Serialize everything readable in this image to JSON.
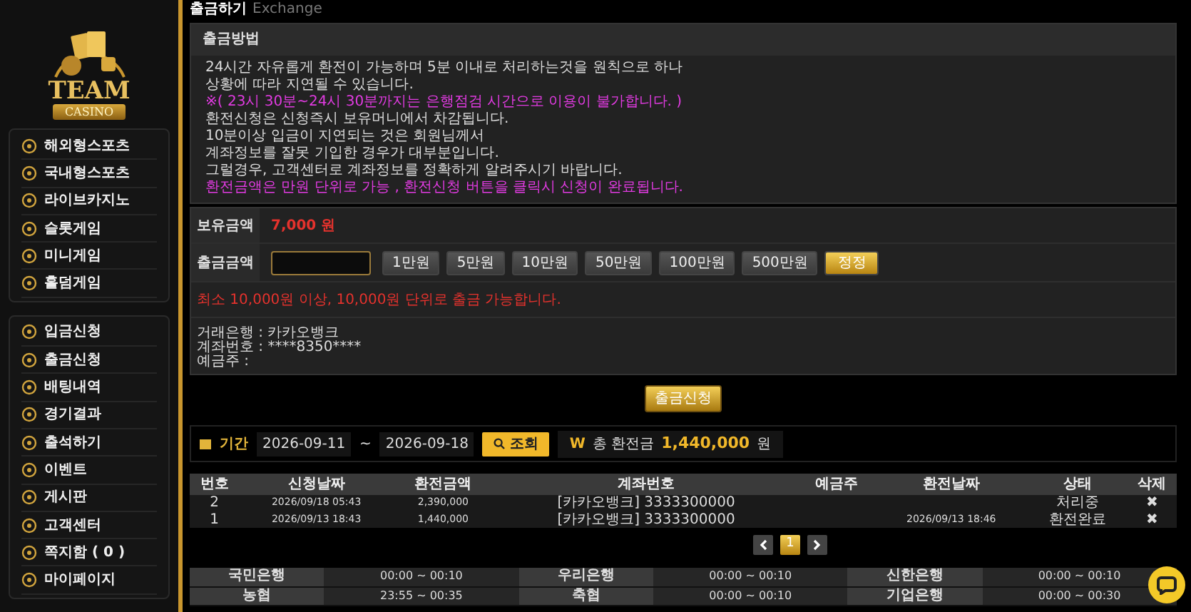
{
  "sidebar": {
    "logo": {
      "title": "TEAM",
      "subtitle": "CASINO"
    },
    "menu_groups": [
      {
        "items": [
          {
            "label": "해외형스포츠"
          },
          {
            "label": "국내형스포츠"
          },
          {
            "label": "라이브카지노"
          },
          {
            "label": "슬롯게임"
          },
          {
            "label": "미니게임"
          },
          {
            "label": "홀덤게임"
          }
        ]
      },
      {
        "items": [
          {
            "label": "입금신청"
          },
          {
            "label": "출금신청"
          },
          {
            "label": "배팅내역"
          },
          {
            "label": "경기결과"
          },
          {
            "label": "출석하기"
          },
          {
            "label": "이벤트"
          },
          {
            "label": "게시판"
          },
          {
            "label": "고객센터"
          },
          {
            "label": "쪽지함 ( 0 )"
          },
          {
            "label": "마이페이지"
          }
        ]
      }
    ]
  },
  "page_title": {
    "title": "출금하기",
    "subtitle": "Exchange"
  },
  "notice": {
    "heading": "출금방법",
    "lines": [
      {
        "text": "24시간 자유롭게 환전이 가능하며 5분 이내로 처리하는것을 원칙으로 하나",
        "kind": "normal"
      },
      {
        "text": "상황에 따라 지연될 수 있습니다.",
        "kind": "normal"
      },
      {
        "text": "※( 23시 30분~24시 30분까지는 은행점검 시간으로 이용이 불가합니다. )",
        "kind": "highlight"
      },
      {
        "text": "환전신청은 신청즉시 보유머니에서 차감됩니다.",
        "kind": "normal"
      },
      {
        "text": "10분이상 입금이 지연되는 것은 회원님께서",
        "kind": "normal"
      },
      {
        "text": "계좌정보를 잘못 기입한 경우가 대부분입니다.",
        "kind": "normal"
      },
      {
        "text": "그럴경우, 고객센터로 계좌정보를 정확하게 알려주시기 바랍니다.",
        "kind": "normal"
      },
      {
        "text": "환전금액은 만원 단위로 가능 , 환전신청 버튼을 클릭시 신청이 완료됩니다.",
        "kind": "highlight"
      }
    ]
  },
  "form": {
    "balance_label": "보유금액",
    "balance": "7,000 원",
    "amount_label": "출금금액",
    "amount_buttons": [
      {
        "label": "1만원",
        "kind": "add"
      },
      {
        "label": "5만원",
        "kind": "add"
      },
      {
        "label": "10만원",
        "kind": "add"
      },
      {
        "label": "50만원",
        "kind": "add"
      },
      {
        "label": "100만원",
        "kind": "add"
      },
      {
        "label": "500만원",
        "kind": "add"
      },
      {
        "label": "정정",
        "kind": "reset"
      }
    ],
    "warning": "최소 10,000원 이상, 10,000원 단위로 출금 가능합니다.",
    "account_lines": [
      "거래은행 : 카카오뱅크",
      "계좌번호 : ****8350****",
      "예금주 :"
    ]
  },
  "submit_button": "출금신청",
  "filter": {
    "label": "기간",
    "date_from": "2026-09-11",
    "separator": "~",
    "date_to": "2026-09-18",
    "search_button": "조회",
    "currency": "W",
    "total_label": "총 환전금",
    "total": "1,440,000",
    "unit": "원"
  },
  "table": {
    "columns": [
      "번호",
      "신청날짜",
      "환전금액",
      "계좌번호",
      "예금주",
      "환전날짜",
      "상태",
      "삭제"
    ],
    "rows": [
      {
        "cells": [
          "2",
          "2026/09/18 05:43",
          "2,390,000",
          "[카카오뱅크] 3333300000",
          "",
          "",
          "처리중"
        ],
        "delete": "✖"
      },
      {
        "cells": [
          "1",
          "2026/09/13 18:43",
          "1,440,000",
          "[카카오뱅크] 3333300000",
          "",
          "2026/09/13 18:46",
          "환전완료"
        ],
        "delete": "✖"
      }
    ]
  },
  "pagination": {
    "pages": [
      {
        "label": "1",
        "selected": true
      }
    ]
  },
  "bank_hours": [
    {
      "bank": "국민은행",
      "hours": "00:00 ~ 00:10"
    },
    {
      "bank": "우리은행",
      "hours": "00:00 ~ 00:10"
    },
    {
      "bank": "신한은행",
      "hours": "00:00 ~ 00:10"
    },
    {
      "bank": "농협",
      "hours": "23:55 ~ 00:35"
    },
    {
      "bank": "축협",
      "hours": "00:00 ~ 00:10"
    },
    {
      "bank": "기업은행",
      "hours": "00:00 ~ 00:30"
    }
  ]
}
